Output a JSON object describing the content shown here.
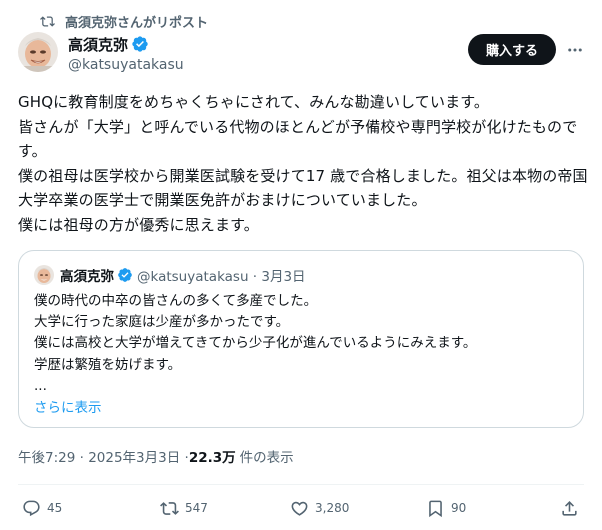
{
  "repost": {
    "label": "高須克弥さんがリポスト",
    "icon": "repost-icon"
  },
  "author": {
    "name": "高須克弥",
    "handle": "@katsuyatakasu",
    "verified_color": "#1d9bf0"
  },
  "header": {
    "subscribe_label": "購入する",
    "more_icon": "more-horizontal-icon"
  },
  "tweet": {
    "text": "GHQに教育制度をめちゃくちゃにされて、みんな勘違いしています。\n皆さんが「大学」と呼んでいる代物のほとんどが予備校や専門学校が化けたものです。\n僕の祖母は医学校から開業医試験を受けて17 歳で合格しました。祖父は本物の帝国大学卒業の医学士で開業医免許がおまけについていました。\n僕には祖母の方が優秀に思えます。"
  },
  "quote": {
    "name": "高須克弥",
    "meta": "@katsuyatakasu · 3月3日",
    "text": "僕の時代の中卒の皆さんの多くて多産でした。\n大学に行った家庭は少産が多かったです。\n僕には高校と大学が増えてきてから少子化が進んでいるようにみえます。\n学歴は繁殖を妨げます。\n...",
    "show_more": "さらに表示"
  },
  "meta": {
    "timestamp": "午後7:29 · 2025年3月3日 · ",
    "views": "22.3万",
    "views_suffix": "件の表示"
  },
  "actions": {
    "reply": "45",
    "retweet": "547",
    "like": "3,280",
    "bookmark": "90"
  },
  "colors": {
    "accent": "#1d9bf0",
    "muted": "#536471",
    "text": "#0f1419",
    "border": "#cfd9de"
  }
}
